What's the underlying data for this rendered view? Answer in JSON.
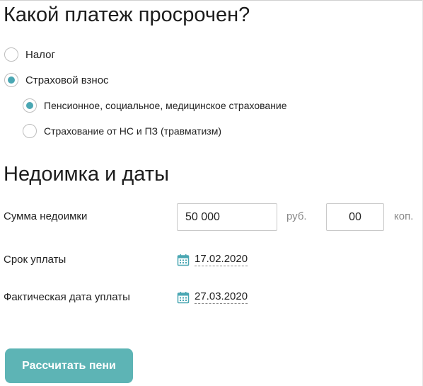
{
  "sections": {
    "overdue_title": "Какой платеж просрочен?",
    "arrears_title": "Недоимка и даты"
  },
  "payment_type": {
    "options": [
      {
        "label": "Налог",
        "checked": false
      },
      {
        "label": "Страховой взнос",
        "checked": true
      }
    ],
    "sub_options": [
      {
        "label": "Пенсионное, социальное, медицинское страхование",
        "checked": true
      },
      {
        "label": "Страхование от НС и ПЗ (травматизм)",
        "checked": false
      }
    ]
  },
  "arrears": {
    "amount_label": "Сумма недоимки",
    "rub_value": "50 000",
    "rub_unit": "руб.",
    "kop_value": "00",
    "kop_unit": "коп."
  },
  "dates": {
    "due_label": "Срок уплаты",
    "due_value": "17.02.2020",
    "actual_label": "Фактическая дата уплаты",
    "actual_value": "27.03.2020"
  },
  "actions": {
    "calculate_label": "Рассчитать пени"
  },
  "colors": {
    "accent": "#4aa7b3",
    "button": "#5db4b5"
  },
  "icons": {
    "date_icon": "calendar-icon"
  }
}
